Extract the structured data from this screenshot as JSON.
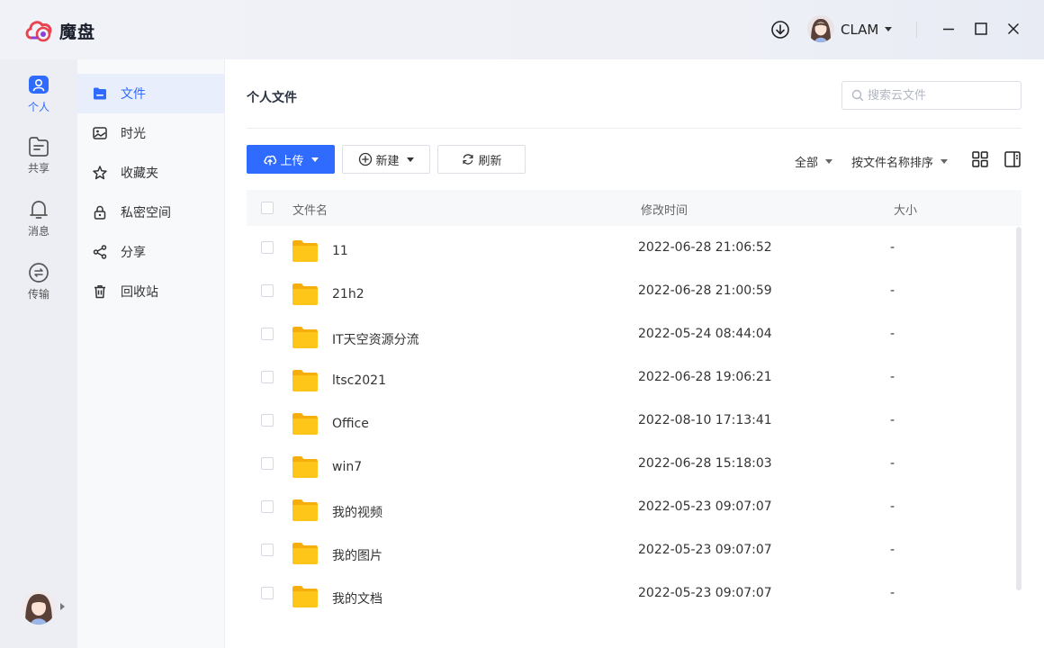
{
  "app": {
    "name": "魔盘",
    "user_name": "CLAM"
  },
  "rail": {
    "items": [
      {
        "label": "个人",
        "icon": "user-icon",
        "active": true
      },
      {
        "label": "共享",
        "icon": "shared-folder-icon",
        "active": false
      },
      {
        "label": "消息",
        "icon": "bell-icon",
        "active": false
      },
      {
        "label": "传输",
        "icon": "transfer-icon",
        "active": false
      }
    ]
  },
  "nav": {
    "items": [
      {
        "label": "文件",
        "icon": "folder-icon",
        "active": true
      },
      {
        "label": "时光",
        "icon": "photo-icon",
        "active": false
      },
      {
        "label": "收藏夹",
        "icon": "star-icon",
        "active": false
      },
      {
        "label": "私密空间",
        "icon": "lock-icon",
        "active": false
      },
      {
        "label": "分享",
        "icon": "share-icon",
        "active": false
      },
      {
        "label": "回收站",
        "icon": "trash-icon",
        "active": false
      }
    ]
  },
  "main": {
    "title": "个人文件",
    "search_placeholder": "搜索云文件",
    "toolbar": {
      "upload_label": "上传",
      "new_label": "新建",
      "refresh_label": "刷新",
      "filter_label": "全部",
      "sort_label": "按文件名称排序"
    },
    "columns": {
      "name": "文件名",
      "modified": "修改时间",
      "size": "大小"
    },
    "rows": [
      {
        "name": "11",
        "modified": "2022-06-28 21:06:52",
        "size": "-"
      },
      {
        "name": "21h2",
        "modified": "2022-06-28 21:00:59",
        "size": "-"
      },
      {
        "name": "IT天空资源分流",
        "modified": "2022-05-24 08:44:04",
        "size": "-"
      },
      {
        "name": "ltsc2021",
        "modified": "2022-06-28 19:06:21",
        "size": "-"
      },
      {
        "name": "Office",
        "modified": "2022-08-10 17:13:41",
        "size": "-"
      },
      {
        "name": "win7",
        "modified": "2022-06-28 15:18:03",
        "size": "-"
      },
      {
        "name": "我的视频",
        "modified": "2022-05-23 09:07:07",
        "size": "-"
      },
      {
        "name": "我的图片",
        "modified": "2022-05-23 09:07:07",
        "size": "-"
      },
      {
        "name": "我的文档",
        "modified": "2022-05-23 09:07:07",
        "size": "-"
      }
    ]
  },
  "colors": {
    "accent": "#2f6bff",
    "folder": "#ffc61a",
    "folder_dark": "#f5ad0c"
  }
}
